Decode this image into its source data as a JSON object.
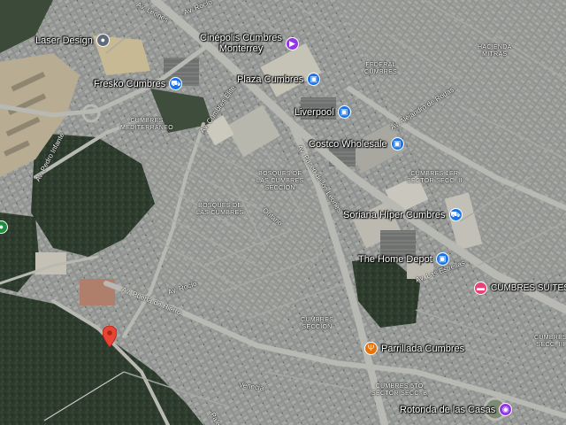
{
  "map": {
    "view": "satellite",
    "colors": {
      "urban": "#8e918f",
      "forest": "#2c3a2c",
      "main_road": "#b9b9b3",
      "shopping_pin": "#1a73e8",
      "cinema_pin": "#9334e6",
      "food_pin": "#e8710a",
      "lodging_pin": "#e8417a",
      "search_marker": "#ea4335"
    },
    "pois": [
      {
        "name": "Laser Design",
        "icon": "place-icon",
        "color": "#5f6b7a"
      },
      {
        "name": "Cinépolis Cumbres\nMonterrey",
        "icon": "cinema-icon",
        "color": "#9334e6"
      },
      {
        "name": "Fresko Cumbres",
        "icon": "shopping-cart-icon",
        "color": "#1a73e8"
      },
      {
        "name": "Plaza Cumbres",
        "icon": "shopping-bag-icon",
        "color": "#1a73e8"
      },
      {
        "name": "Liverpool",
        "icon": "shopping-bag-icon",
        "color": "#1a73e8"
      },
      {
        "name": "Costco Wholesale",
        "icon": "shopping-bag-icon",
        "color": "#1a73e8"
      },
      {
        "name": "Soriana Híper Cumbres",
        "icon": "shopping-cart-icon",
        "color": "#1a73e8"
      },
      {
        "name": "The Home Depot",
        "icon": "shopping-bag-icon",
        "color": "#1a73e8"
      },
      {
        "name": "CUMBRES SUITES",
        "icon": "bed-icon",
        "color": "#e8417a"
      },
      {
        "name": "Parrillada Cumbres",
        "icon": "fork-knife-icon",
        "color": "#e8710a"
      },
      {
        "name": "Rotonda de las Casas",
        "icon": "camera-icon",
        "color": "#9334e6"
      }
    ],
    "areas": [
      "CUMBRES\nMEDITERRÁNEO",
      "BOSQUES DE\nLAS CUMBRES\nSECCIÓN",
      "BOSQUES DE\nLAS CUMBRES",
      "HACIENDA\nMITRAS",
      "FEDERAL\nCUMBRES",
      "CUMBRES 1ER\nSECTOR SECC. II",
      "CUMBRES\nSECCIÓN",
      "CUMBRES 5TO\nSECTOR SECC. B",
      "CUMBRES\nSECC. III"
    ],
    "streets": [
      "Av. Pedro Infante",
      "Av. Paseo de los Leones",
      "Av. Alejandro de Rodas",
      "Av. Puerta de Hierro",
      "Av. Rocío",
      "Av. Rocío",
      "Venecia",
      "Palermo",
      "Av. Leones",
      "Ontario",
      "Av. Cumbres Elite",
      "Av. Las Estrellas"
    ]
  }
}
